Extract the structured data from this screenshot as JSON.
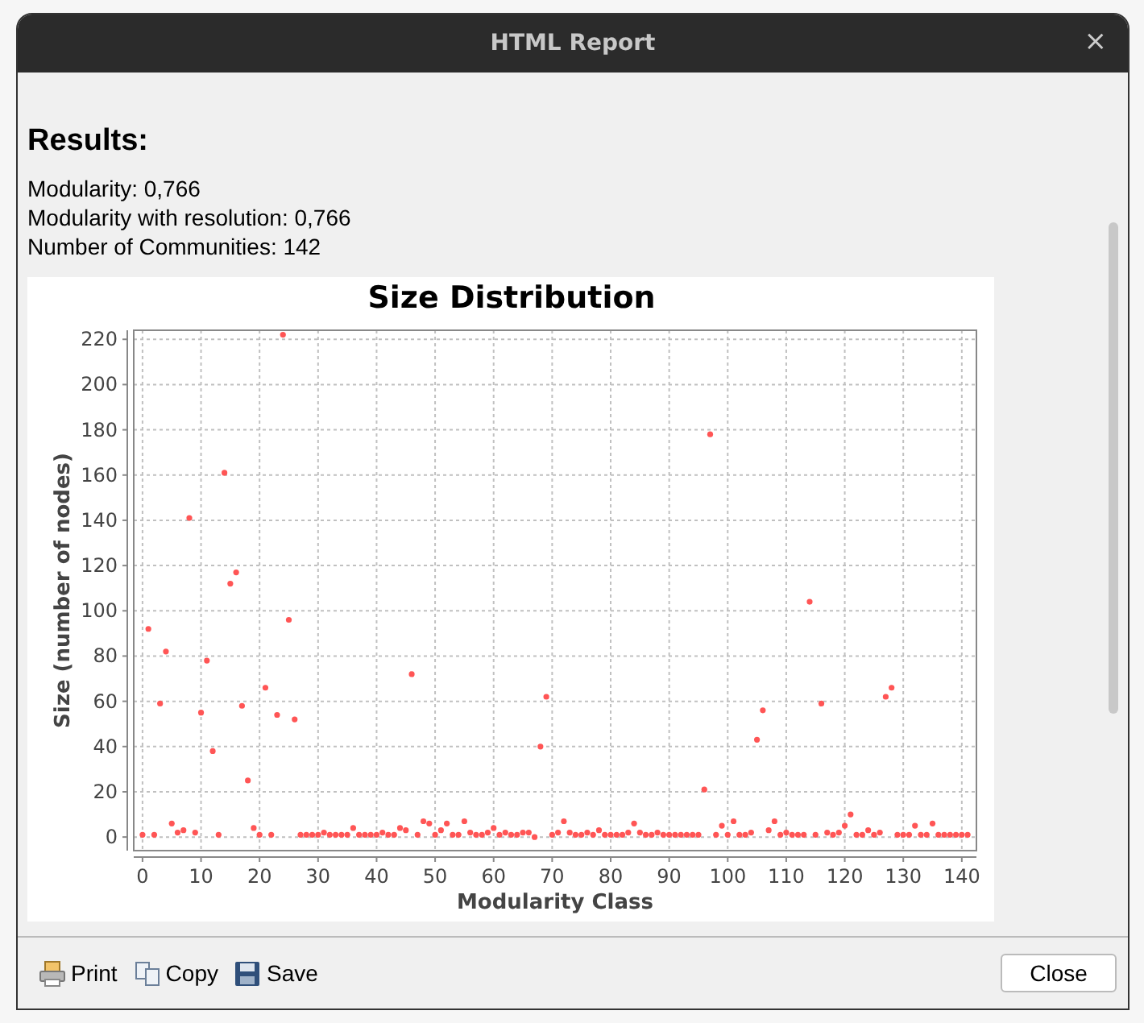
{
  "window": {
    "title": "HTML Report",
    "close_glyph": "×"
  },
  "report": {
    "heading": "Results:",
    "lines": [
      "Modularity: 0,766",
      "Modularity with resolution: 0,766",
      "Number of Communities: 142"
    ],
    "chart_data": {
      "type": "scatter",
      "grid": true,
      "title": "Size Distribution",
      "xlabel": "Modularity Class",
      "ylabel": "Size (number of nodes)",
      "xlim": [
        -1.5,
        142.5
      ],
      "ylim": [
        -6,
        224
      ],
      "xticks": [
        0,
        10,
        20,
        30,
        40,
        50,
        60,
        70,
        80,
        90,
        100,
        110,
        120,
        130,
        140
      ],
      "yticks": [
        0,
        20,
        40,
        60,
        80,
        100,
        120,
        140,
        160,
        180,
        200,
        220
      ],
      "x": [
        0,
        1,
        2,
        3,
        4,
        5,
        6,
        7,
        8,
        9,
        10,
        11,
        12,
        13,
        14,
        15,
        16,
        17,
        18,
        19,
        20,
        21,
        22,
        23,
        24,
        25,
        26,
        27,
        28,
        29,
        30,
        31,
        32,
        33,
        34,
        35,
        36,
        37,
        38,
        39,
        40,
        41,
        42,
        43,
        44,
        45,
        46,
        47,
        48,
        49,
        50,
        51,
        52,
        53,
        54,
        55,
        56,
        57,
        58,
        59,
        60,
        61,
        62,
        63,
        64,
        65,
        66,
        67,
        68,
        69,
        70,
        71,
        72,
        73,
        74,
        75,
        76,
        77,
        78,
        79,
        80,
        81,
        82,
        83,
        84,
        85,
        86,
        87,
        88,
        89,
        90,
        91,
        92,
        93,
        94,
        95,
        96,
        97,
        98,
        99,
        100,
        101,
        102,
        103,
        104,
        105,
        106,
        107,
        108,
        109,
        110,
        111,
        112,
        113,
        114,
        115,
        116,
        117,
        118,
        119,
        120,
        121,
        122,
        123,
        124,
        125,
        126,
        127,
        128,
        129,
        130,
        131,
        132,
        133,
        134,
        135,
        136,
        137,
        138,
        139,
        140,
        141
      ],
      "series": [
        {
          "color": "#ff5555",
          "values": [
            1,
            92,
            1,
            59,
            82,
            6,
            2,
            3,
            141,
            2,
            55,
            78,
            38,
            1,
            161,
            112,
            117,
            58,
            25,
            4,
            1,
            66,
            1,
            54,
            222,
            96,
            52,
            1,
            1,
            1,
            1,
            2,
            1,
            1,
            1,
            1,
            4,
            1,
            1,
            1,
            1,
            2,
            1,
            1,
            4,
            3,
            72,
            1,
            7,
            6,
            1,
            3,
            6,
            1,
            1,
            7,
            2,
            1,
            1,
            2,
            4,
            1,
            2,
            1,
            1,
            2,
            2,
            0,
            40,
            62,
            1,
            2,
            7,
            2,
            1,
            1,
            2,
            1,
            3,
            1,
            1,
            1,
            1,
            2,
            6,
            2,
            1,
            1,
            2,
            1,
            1,
            1,
            1,
            1,
            1,
            1,
            21,
            178,
            1,
            5,
            1,
            7,
            1,
            1,
            2,
            43,
            56,
            3,
            7,
            1,
            2,
            1,
            1,
            1,
            104,
            1,
            59,
            2,
            1,
            2,
            5,
            10,
            1,
            1,
            3,
            1,
            2,
            62,
            66,
            1,
            1,
            1,
            5,
            1,
            1,
            6,
            1,
            1,
            1,
            1,
            1,
            1
          ]
        }
      ]
    }
  },
  "buttons": [
    {
      "kind": "print",
      "label": "Print"
    },
    {
      "kind": "copy",
      "label": "Copy"
    },
    {
      "kind": "save",
      "label": "Save"
    }
  ],
  "close_button": "Close"
}
